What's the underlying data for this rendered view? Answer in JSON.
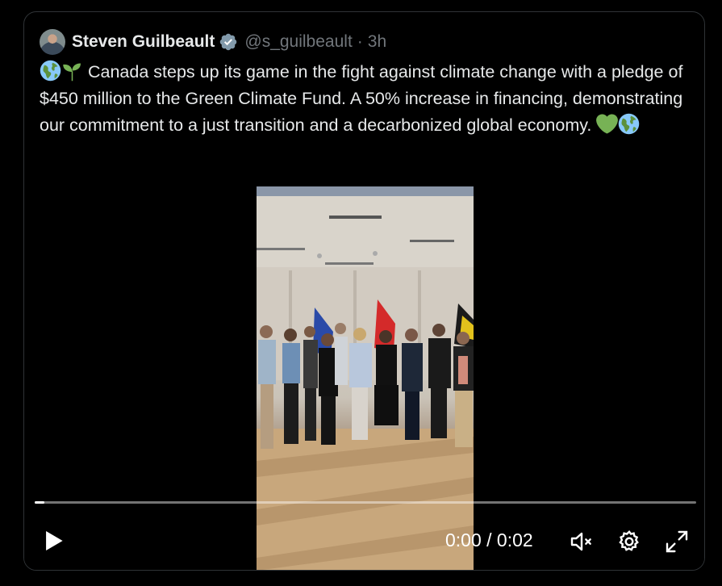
{
  "tweet": {
    "author_name": "Steven Guilbeault",
    "handle": "@s_guilbeault",
    "separator": "·",
    "time": "3h",
    "text_lead": "Canada steps up its game in the fight against climate change with a pledge of $450 million to the Green Climate Fund. A 50% increase in financing, demonstrating our commitment to a just transition and a decarbonized global economy.",
    "verified_color": "#829aab",
    "icons": [
      "globe-americas-icon",
      "seedling-icon",
      "green-heart-icon",
      "globe-americas-icon"
    ]
  },
  "video": {
    "current_time": "0:00",
    "time_separator": "/",
    "duration": "0:02",
    "time_display": "0:00 / 0:02",
    "progress_fraction": 0.01,
    "state": "paused",
    "muted": true,
    "controls": [
      "play-icon",
      "mute-icon",
      "settings-gear-icon",
      "fullscreen-icon"
    ]
  },
  "colors": {
    "background": "#000000",
    "border": "#2f3336",
    "text": "#e7e9ea",
    "secondary_text": "#71767b"
  }
}
